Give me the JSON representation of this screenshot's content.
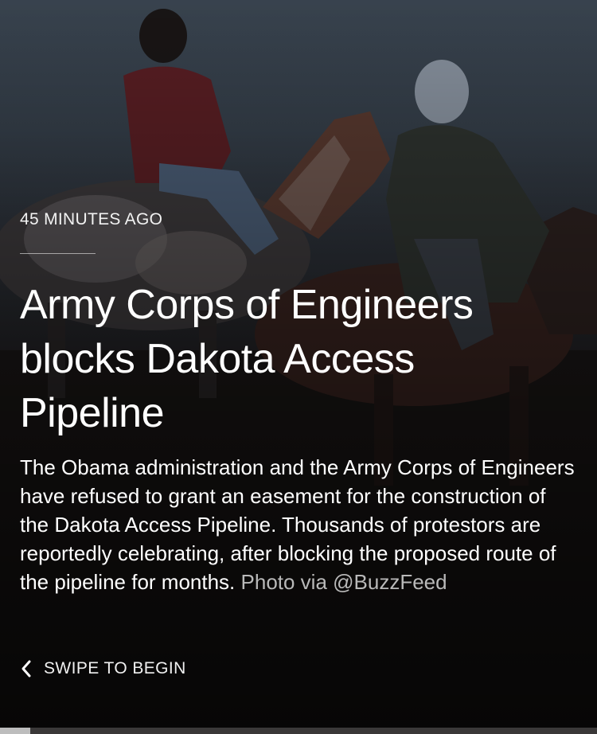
{
  "story": {
    "timestamp": "45 MINUTES AGO",
    "headline": "Army Corps of Engineers blocks Dakota Access Pipeline",
    "summary": "The Obama administration and the Army Corps of Engineers have refused to grant an easement for the construction of the Dakota Access Pipeline. Thousands of protestors are reportedly celebrating, after blocking the proposed route of the pipeline for months.",
    "photo_credit": "Photo via @BuzzFeed"
  },
  "navigation": {
    "swipe_label": "SWIPE TO BEGIN",
    "swipe_icon": "chevron-left-icon"
  },
  "progress": {
    "fraction": 0.05
  },
  "colors": {
    "text_primary": "#ffffff",
    "text_secondary": "#b9b9b9",
    "progress_fill": "#bdbdbd",
    "progress_track": "#3a3838"
  }
}
